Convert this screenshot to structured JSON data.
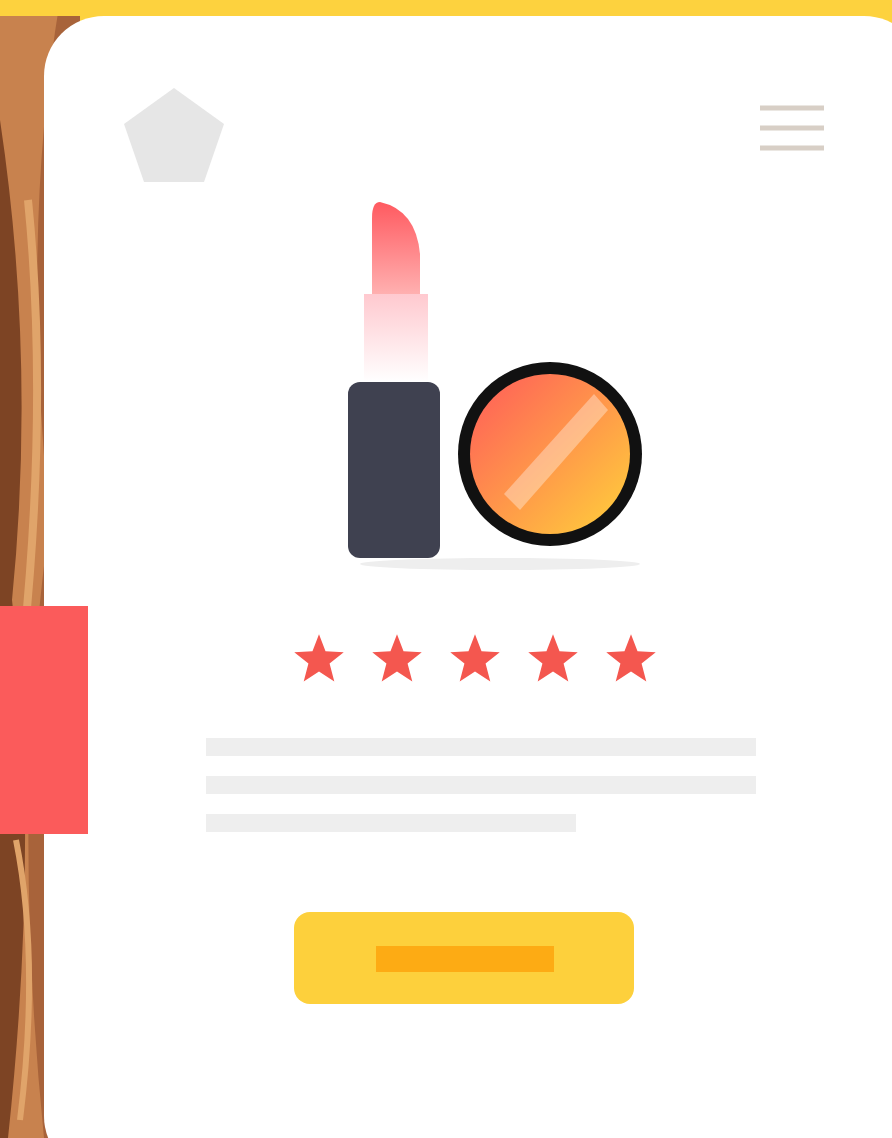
{
  "product": {
    "stars": 5
  }
}
